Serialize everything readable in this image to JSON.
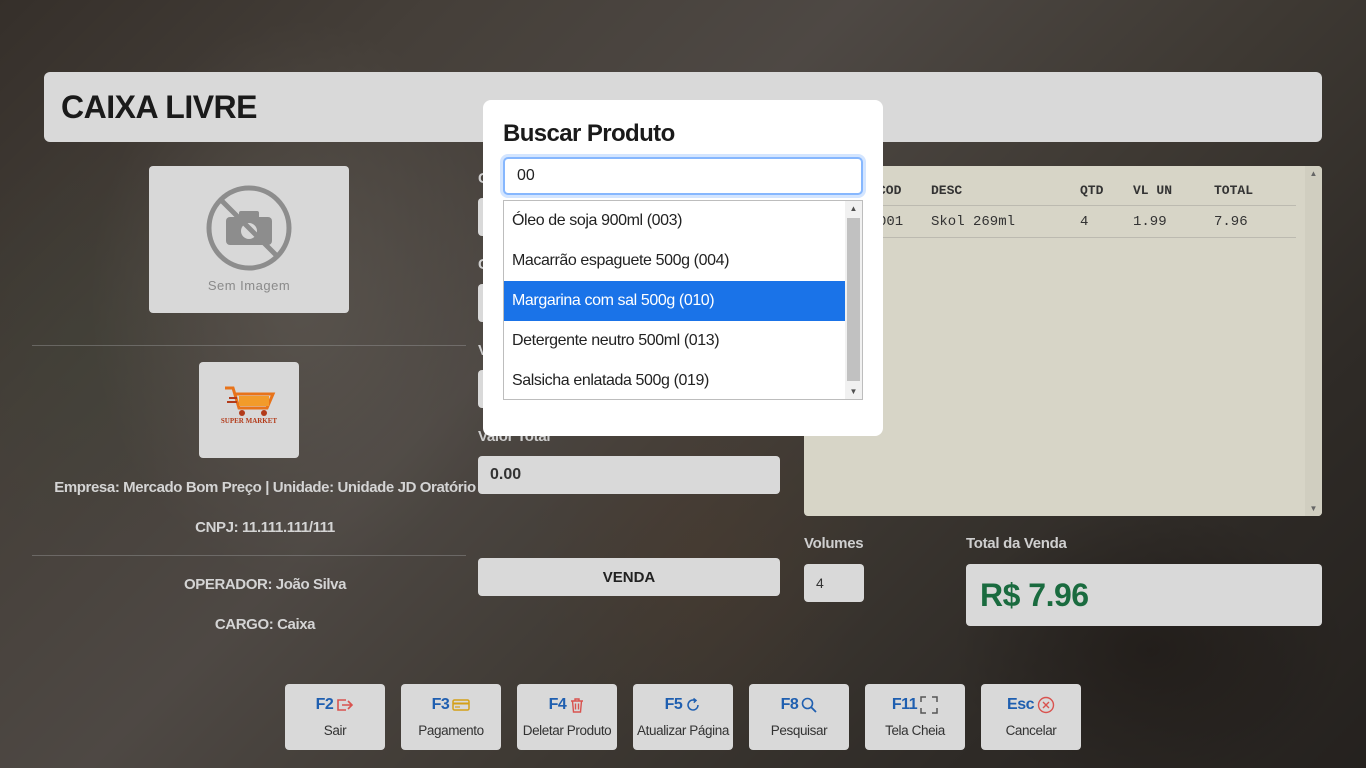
{
  "header": {
    "title": "CAIXA LIVRE"
  },
  "product_image": {
    "placeholder": "Sem Imagem"
  },
  "company": {
    "logo_text": "SUPER MARKET",
    "empresa": "Empresa: Mercado Bom Preço | Unidade: Unidade JD Oratório",
    "cnpj": "CNPJ: 11.111.111/111"
  },
  "operator": {
    "name": "OPERADOR: João Silva",
    "role": "CARGO: Caixa"
  },
  "middle": {
    "label_1_partial": "C",
    "label_2_partial": "C",
    "label_3_partial": "V",
    "valor_total_label": "Valor Total",
    "valor_total": "0.00",
    "venda_button": "VENDA"
  },
  "items_table": {
    "headers": [
      "COD",
      "DESC",
      "QTD",
      "VL UN",
      "TOTAL"
    ],
    "rows": [
      [
        "001",
        "Skol 269ml",
        "4",
        "1.99",
        "7.96"
      ]
    ]
  },
  "volumes": {
    "label": "Volumes",
    "value": "4"
  },
  "sale_total": {
    "label": "Total da Venda",
    "value": "R$ 7.96"
  },
  "function_keys": [
    {
      "key": "F2",
      "label": "Sair",
      "icon": "exit-icon"
    },
    {
      "key": "F3",
      "label": "Pagamento",
      "icon": "credit-card-icon"
    },
    {
      "key": "F4",
      "label": "Deletar Produto",
      "icon": "trash-icon"
    },
    {
      "key": "F5",
      "label": "Atualizar Página",
      "icon": "refresh-icon"
    },
    {
      "key": "F8",
      "label": "Pesquisar",
      "icon": "search-icon"
    },
    {
      "key": "F11",
      "label": "Tela Cheia",
      "icon": "fullscreen-icon"
    },
    {
      "key": "Esc",
      "label": "Cancelar",
      "icon": "cancel-circle-icon"
    }
  ],
  "colors": {
    "accent_blue": "#1f5fb0",
    "selected_option": "#1a73e8",
    "total_green": "#1a6b3f",
    "trash_red": "#d9534f",
    "card_yellow": "#d4a017",
    "cancel_red": "#d9534f"
  },
  "search_modal": {
    "title": "Buscar Produto",
    "query": "00",
    "options": [
      {
        "label": "Óleo de soja 900ml (003)",
        "selected": false
      },
      {
        "label": "Macarrão espaguete 500g (004)",
        "selected": false
      },
      {
        "label": "Margarina com sal 500g (010)",
        "selected": true
      },
      {
        "label": "Detergente neutro 500ml (013)",
        "selected": false
      },
      {
        "label": "Salsicha enlatada 500g (019)",
        "selected": false
      }
    ]
  }
}
